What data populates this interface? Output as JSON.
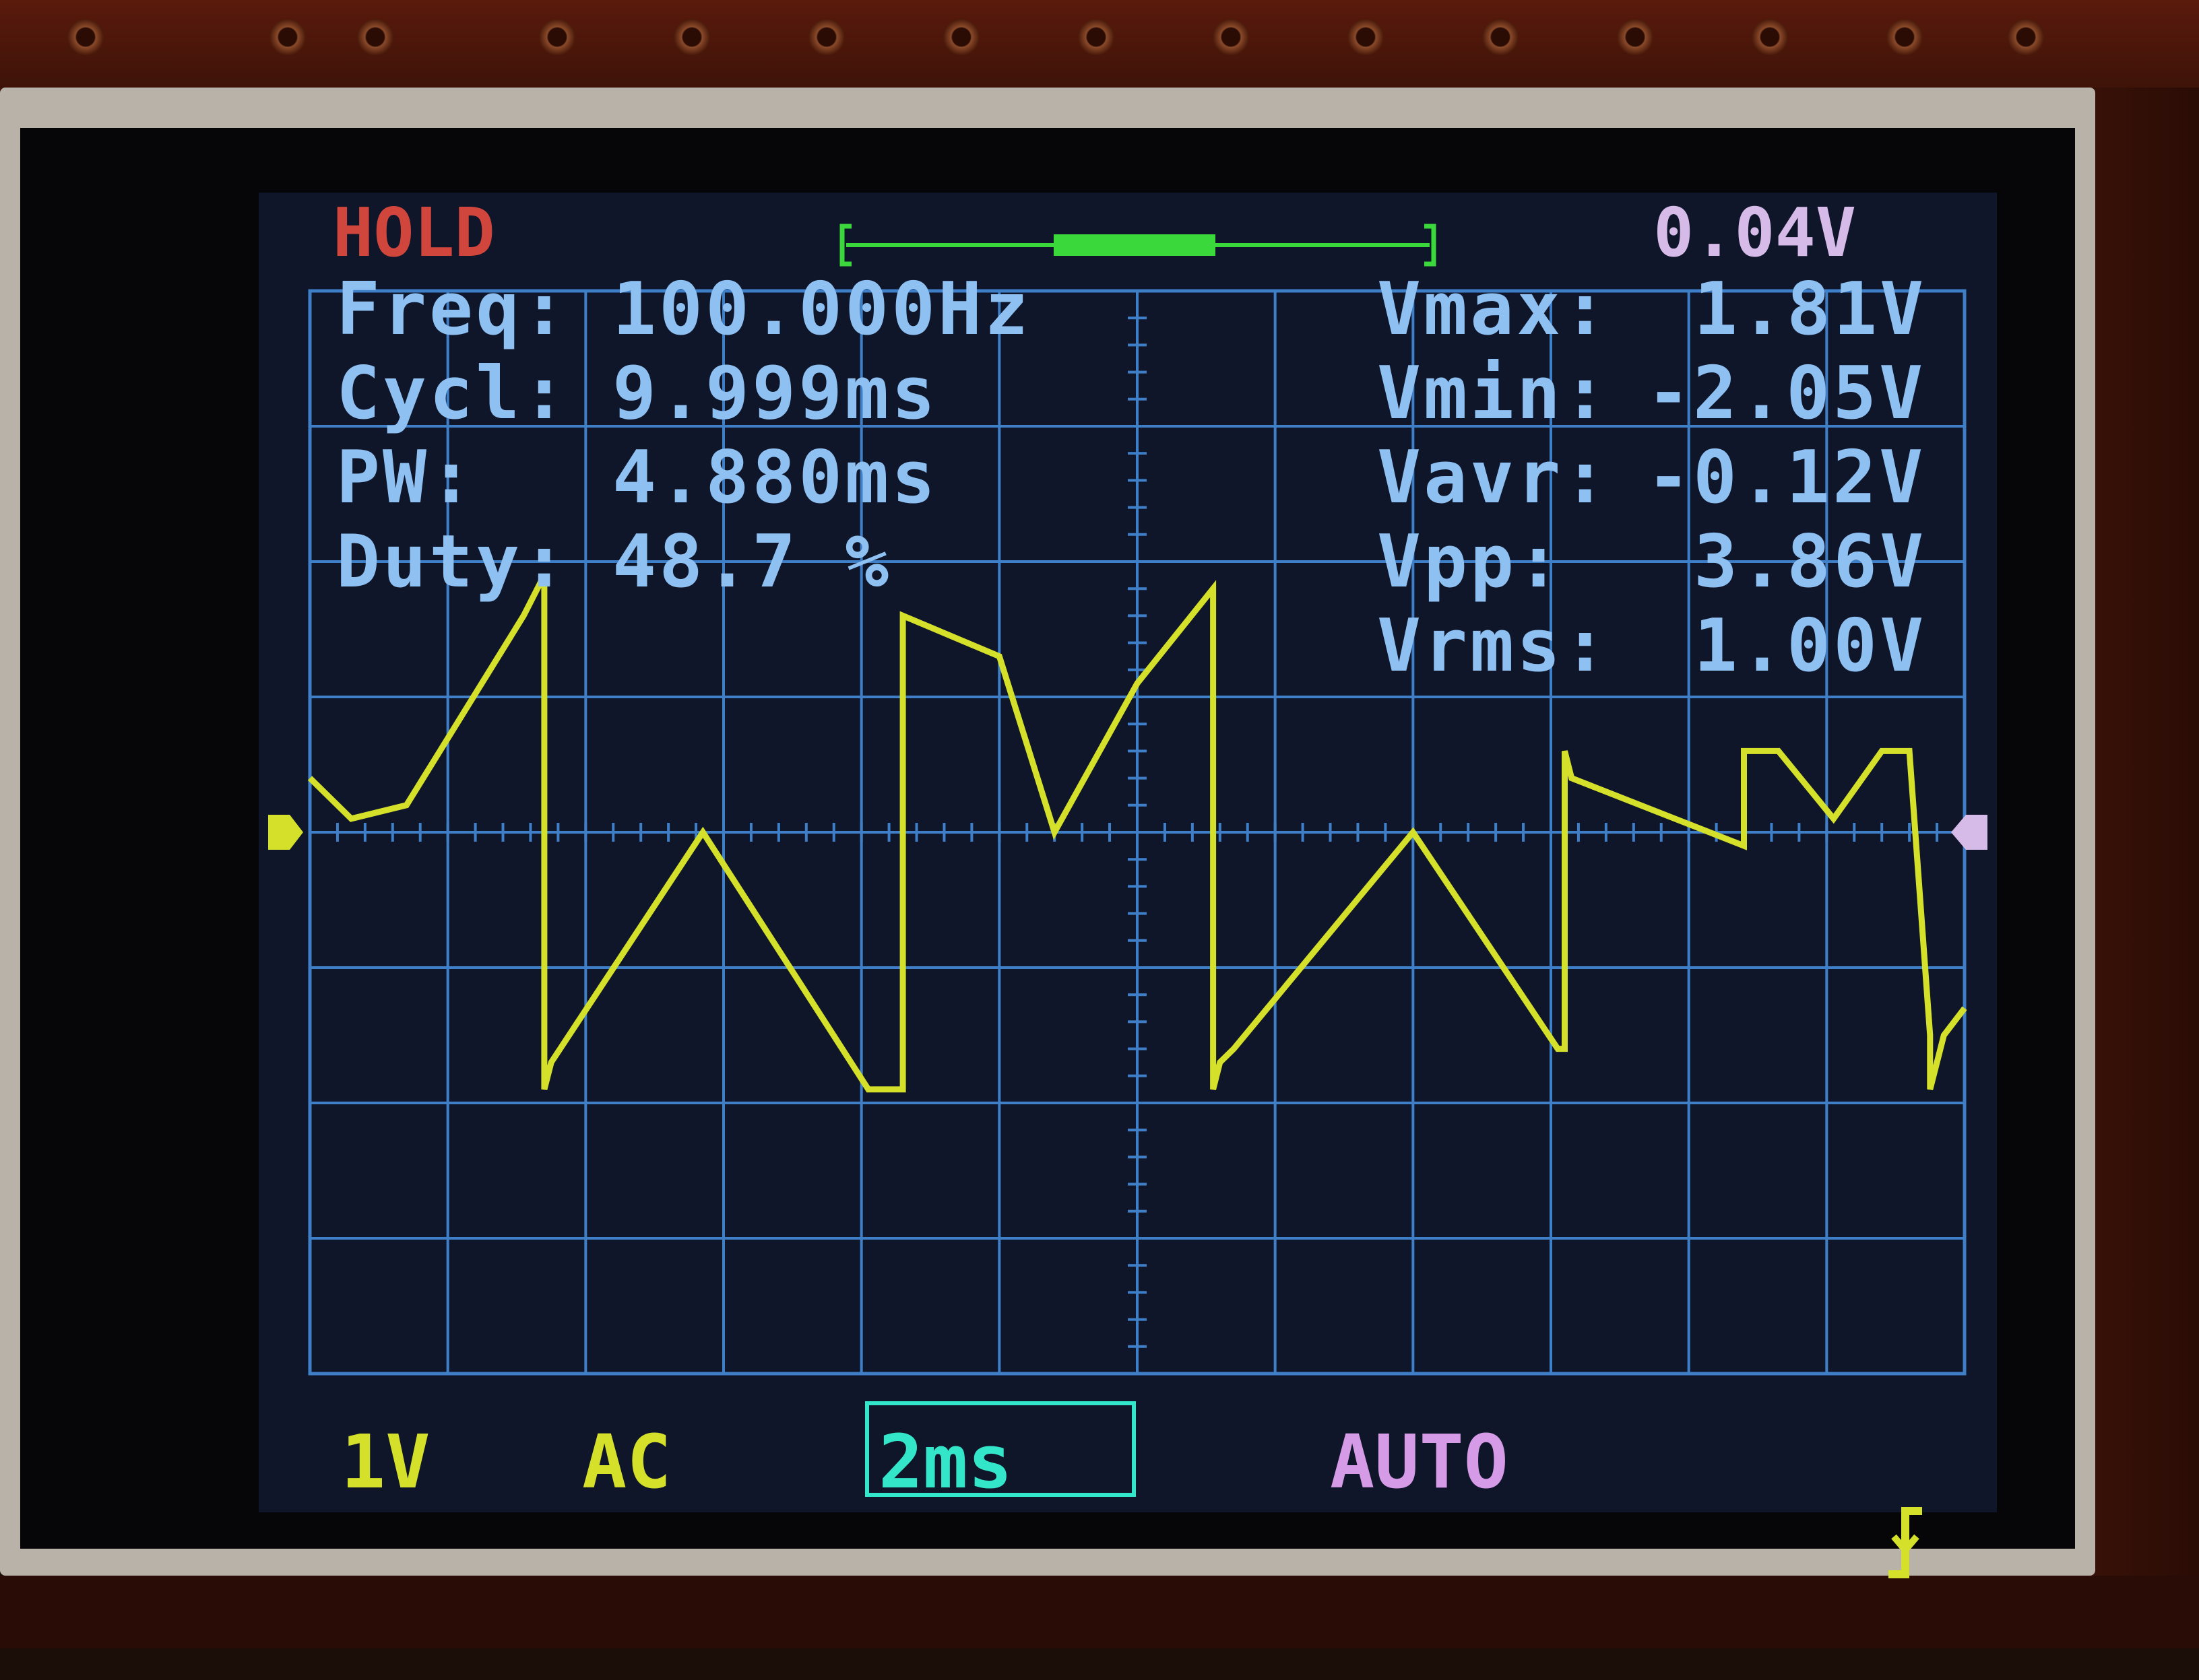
{
  "status": {
    "mode": "HOLD",
    "trigger_level": "0.04V"
  },
  "measurements_left": [
    {
      "label": "Freq:",
      "value": "100.000Hz"
    },
    {
      "label": "Cycl:",
      "value": "9.999ms"
    },
    {
      "label": "PW:",
      "value": "4.880ms"
    },
    {
      "label": "Duty:",
      "value": "48.7 %"
    }
  ],
  "measurements_right": [
    {
      "label": "Vmax:",
      "value": "1.81V"
    },
    {
      "label": "Vmin:",
      "value": "-2.05V"
    },
    {
      "label": "Vavr:",
      "value": "-0.12V"
    },
    {
      "label": "Vpp:",
      "value": "3.86V"
    },
    {
      "label": "Vrms:",
      "value": "1.00V"
    }
  ],
  "bottom_bar": {
    "volts_per_div": "1V",
    "coupling": "AC",
    "timebase": "2ms",
    "trigger_mode": "AUTO",
    "trigger_edge_icon": "falling-edge-icon"
  },
  "colors": {
    "trace": "#d4e02a",
    "grid": "#3f7fc8",
    "hold": "#d0463c",
    "trigger_level": "#d6bbe8",
    "measurements": "#8ec0f2",
    "timebase_highlight": "#34e6c9",
    "trigger_mode": "#d59be6",
    "buffer_indicator": "#3bd83b"
  },
  "chart_data": {
    "type": "line",
    "xlabel": "",
    "ylabel": "",
    "xlim": [
      -12,
      12
    ],
    "ylim": [
      -4,
      4
    ],
    "grid": true,
    "series": [
      {
        "x": [
          -12.0,
          -11.4,
          -10.6,
          -8.9,
          -8.6,
          -8.6,
          -8.5,
          -6.3,
          -3.9,
          -3.4,
          -3.4,
          -2.0,
          -1.2,
          0.0,
          1.1,
          1.1,
          1.2,
          1.4,
          4.0,
          6.1,
          6.2,
          6.2,
          6.3,
          8.8,
          8.8,
          9.0,
          9.3,
          10.1,
          10.8,
          11.2,
          11.5,
          11.5,
          11.7,
          12.0
        ],
        "y": [
          0.4,
          0.1,
          0.2,
          1.6,
          1.9,
          -1.9,
          -1.7,
          0.0,
          -1.9,
          -1.9,
          1.6,
          1.3,
          0.0,
          1.1,
          1.8,
          -1.9,
          -1.7,
          -1.6,
          0.0,
          -1.6,
          -1.6,
          0.6,
          0.4,
          -0.1,
          0.6,
          0.6,
          0.6,
          0.1,
          0.6,
          0.6,
          -1.5,
          -1.9,
          -1.5,
          -1.3
        ]
      }
    ]
  }
}
